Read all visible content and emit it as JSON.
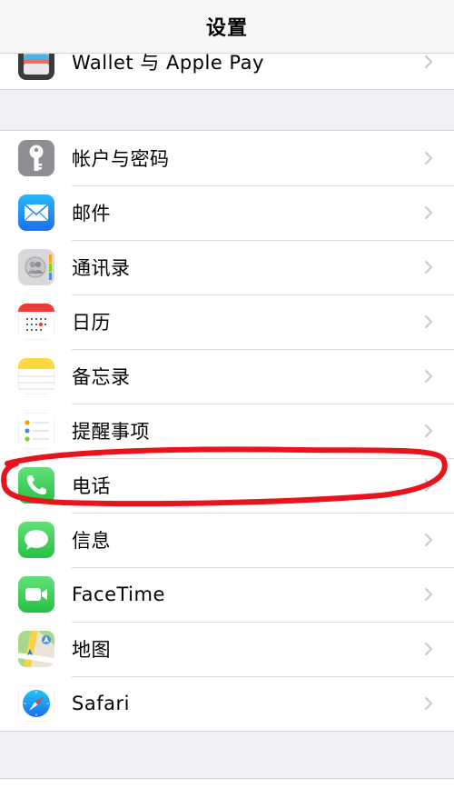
{
  "header": {
    "title": "设置"
  },
  "top_group": [
    {
      "label": "Wallet 与 Apple Pay",
      "icon": "wallet-icon"
    }
  ],
  "main_group": [
    {
      "label": "帐户与密码",
      "icon": "key-icon"
    },
    {
      "label": "邮件",
      "icon": "mail-icon"
    },
    {
      "label": "通讯录",
      "icon": "contacts-icon"
    },
    {
      "label": "日历",
      "icon": "calendar-icon"
    },
    {
      "label": "备忘录",
      "icon": "notes-icon"
    },
    {
      "label": "提醒事项",
      "icon": "reminders-icon"
    },
    {
      "label": "电话",
      "icon": "phone-icon"
    },
    {
      "label": "信息",
      "icon": "messages-icon"
    },
    {
      "label": "FaceTime",
      "icon": "facetime-icon"
    },
    {
      "label": "地图",
      "icon": "maps-icon"
    },
    {
      "label": "Safari",
      "icon": "safari-icon"
    }
  ],
  "colors": {
    "background": "#efeff4",
    "separator": "#dcdce0",
    "chevron": "#c7c7cc",
    "annotation": "#e8131b"
  }
}
